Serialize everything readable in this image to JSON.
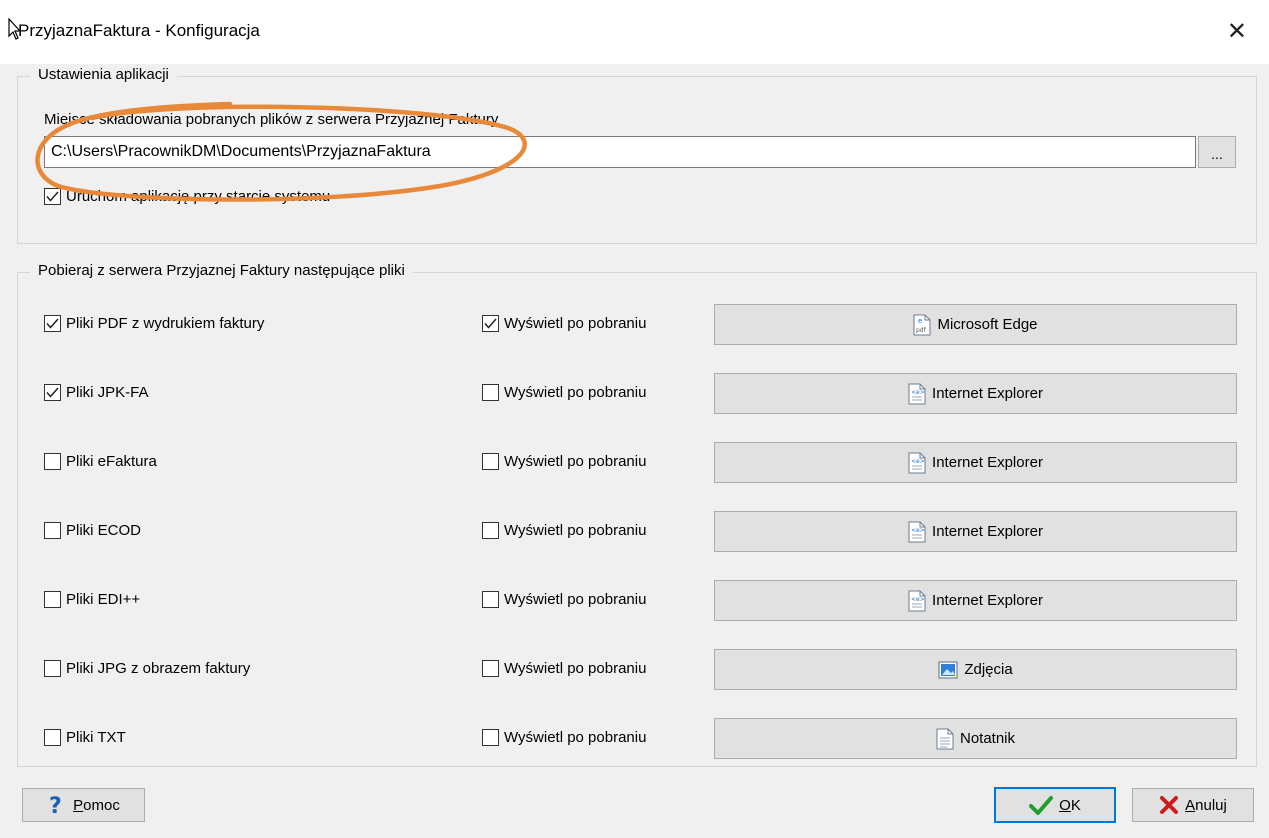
{
  "window": {
    "title": "PrzyjaznaFaktura - Konfiguracja",
    "close_symbol": "✕"
  },
  "app_settings": {
    "legend": "Ustawienia aplikacji",
    "folder_label": "Miejsce składowania pobranych plików z serwera Przyjaznej Faktury",
    "folder_value": "C:\\Users\\PracownikDM\\Documents\\PrzyjaznaFaktura",
    "browse_label": "...",
    "autostart": {
      "label": "Uruchom aplikację przy starcie systemu",
      "checked": true
    }
  },
  "download": {
    "legend": "Pobieraj z serwera Przyjaznej Faktury następujące pliki",
    "rows": [
      {
        "file_label": "Pliki PDF z wydrukiem faktury",
        "file_checked": true,
        "show_label": "Wyświetl po pobraniu",
        "show_checked": true,
        "app": "Microsoft Edge",
        "app_icon": "pdf-document-icon"
      },
      {
        "file_label": "Pliki JPK-FA",
        "file_checked": true,
        "show_label": "Wyświetl po pobraniu",
        "show_checked": false,
        "app": "Internet Explorer",
        "app_icon": "xml-document-icon"
      },
      {
        "file_label": "Pliki eFaktura",
        "file_checked": false,
        "show_label": "Wyświetl po pobraniu",
        "show_checked": false,
        "app": "Internet Explorer",
        "app_icon": "xml-document-icon"
      },
      {
        "file_label": "Pliki ECOD",
        "file_checked": false,
        "show_label": "Wyświetl po pobraniu",
        "show_checked": false,
        "app": "Internet Explorer",
        "app_icon": "xml-document-icon"
      },
      {
        "file_label": "Pliki EDI++",
        "file_checked": false,
        "show_label": "Wyświetl po pobraniu",
        "show_checked": false,
        "app": "Internet Explorer",
        "app_icon": "xml-document-icon"
      },
      {
        "file_label": "Pliki JPG z obrazem faktury",
        "file_checked": false,
        "show_label": "Wyświetl po pobraniu",
        "show_checked": false,
        "app": "Zdjęcia",
        "app_icon": "photos-icon"
      },
      {
        "file_label": "Pliki TXT",
        "file_checked": false,
        "show_label": "Wyświetl po pobraniu",
        "show_checked": false,
        "app": "Notatnik",
        "app_icon": "notepad-icon"
      }
    ]
  },
  "footer": {
    "help": {
      "mnemonic": "P",
      "rest": "omoc",
      "icon": "question-icon"
    },
    "ok": {
      "mnemonic": "O",
      "rest": "K",
      "icon": "checkmark-icon"
    },
    "cancel": {
      "mnemonic": "A",
      "rest": "nuluj",
      "icon": "cross-icon"
    }
  },
  "colors": {
    "dialog_bg": "#f0f0f0",
    "button_bg": "#e1e1e1",
    "default_button_border": "#0078d7",
    "highlight_ellipse": "#e8893a"
  }
}
